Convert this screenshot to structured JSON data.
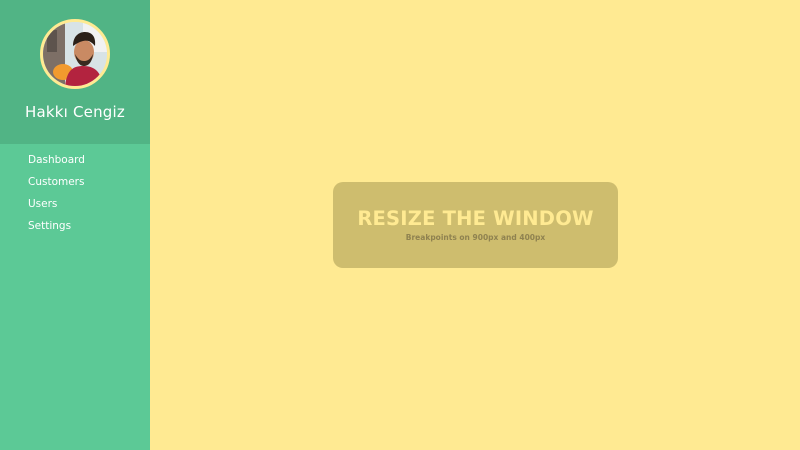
{
  "profile": {
    "name": "Hakkı Cengiz",
    "avatar_icon": "user-photo-avatar"
  },
  "nav": {
    "items": [
      {
        "label": "Dashboard"
      },
      {
        "label": "Customers"
      },
      {
        "label": "Users"
      },
      {
        "label": "Settings"
      }
    ]
  },
  "notice": {
    "title": "RESIZE THE WINDOW",
    "subtitle": "Breakpoints on 900px and 400px"
  },
  "colors": {
    "sidebar": "#5cc996",
    "profile_header": "#51b485",
    "background": "#ffea92",
    "notice_box": "#cebd6e",
    "notice_subtitle": "#8f8250"
  }
}
